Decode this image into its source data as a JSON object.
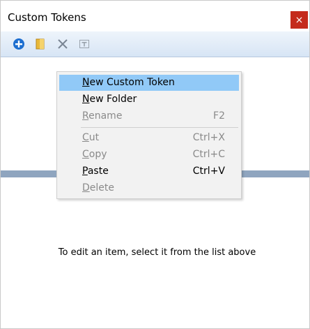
{
  "window": {
    "title": "Custom Tokens",
    "close_glyph": "×"
  },
  "toolbar": {
    "buttons": [
      {
        "icon": "add-circle-icon"
      },
      {
        "icon": "new-folder-icon"
      },
      {
        "icon": "delete-x-icon"
      },
      {
        "icon": "rename-icon"
      }
    ]
  },
  "context_menu": {
    "items": [
      {
        "mnemonic": "N",
        "rest": "ew Custom Token",
        "shortcut": "",
        "enabled": true,
        "highlighted": true
      },
      {
        "mnemonic": "N",
        "rest": "ew Folder",
        "shortcut": "",
        "enabled": true,
        "highlighted": false
      },
      {
        "mnemonic": "R",
        "rest": "ename",
        "shortcut": "F2",
        "enabled": false,
        "highlighted": false
      },
      {
        "mnemonic": "C",
        "rest": "ut",
        "shortcut": "Ctrl+X",
        "enabled": false,
        "highlighted": false
      },
      {
        "mnemonic": "C",
        "rest": "opy",
        "shortcut": "Ctrl+C",
        "enabled": false,
        "highlighted": false
      },
      {
        "mnemonic": "P",
        "rest": "aste",
        "shortcut": "Ctrl+V",
        "enabled": true,
        "highlighted": false
      },
      {
        "mnemonic": "D",
        "rest": "elete",
        "shortcut": "",
        "enabled": false,
        "highlighted": false
      }
    ]
  },
  "detail": {
    "hint": "To edit an item, select it from the list above"
  }
}
